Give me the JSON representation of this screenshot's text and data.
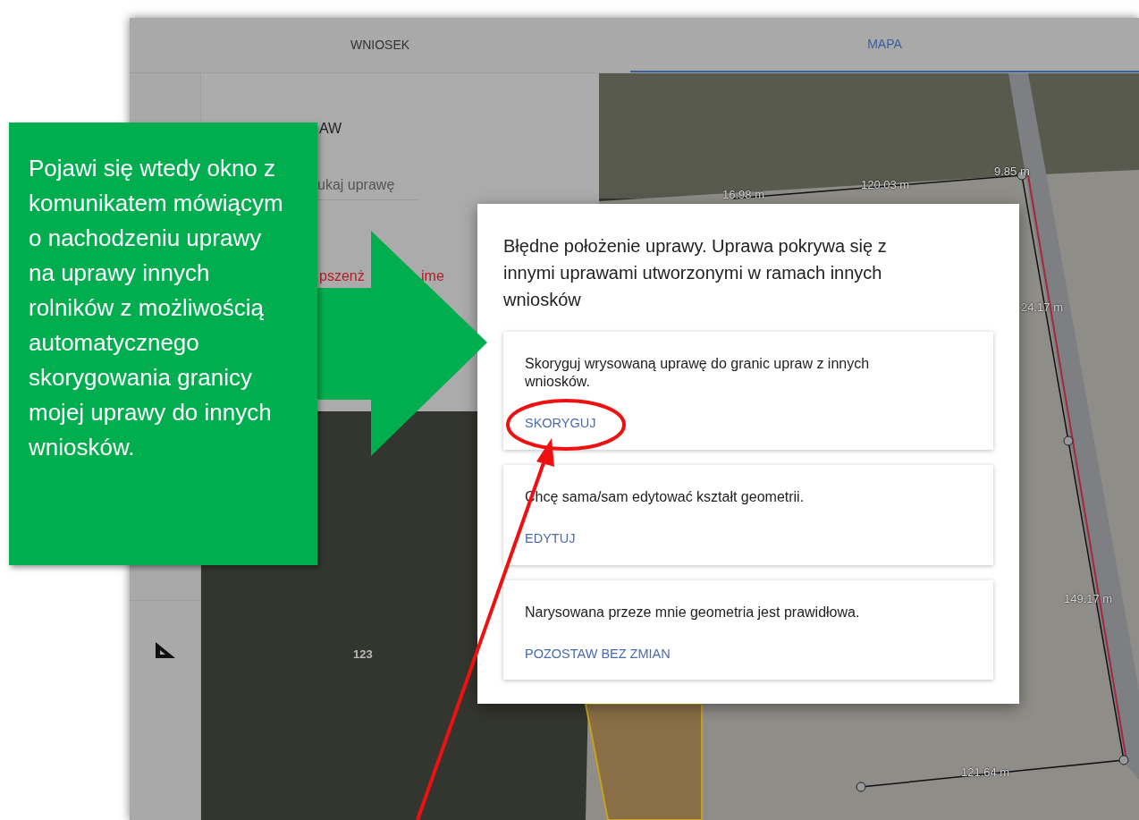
{
  "tabs": [
    {
      "label": "WNIOSEK",
      "selected": false
    },
    {
      "label": "MAPA",
      "selected": true
    }
  ],
  "crop_list": {
    "heading": "AW",
    "search": {
      "placeholder": "ukaj uprawę"
    },
    "item_fragments": [
      "pszenż",
      "ime"
    ]
  },
  "map": {
    "labels": [
      "16.98 m",
      "120.03 m",
      "9.85 m",
      "24.17 m",
      "149.17 m",
      "121.64 m"
    ],
    "parcel_number": "123"
  },
  "dialog": {
    "title": "Błędne położenie uprawy. Uprawa pokrywa się z innymi uprawami utworzonymi w ramach innych wniosków",
    "options": [
      {
        "text": "Skoryguj wrysowaną uprawę do granic upraw z innych wniosków.",
        "action": "SKORYGUJ"
      },
      {
        "text": "Chcę sama/sam edytować kształt geometrii.",
        "action": "EDYTUJ"
      },
      {
        "text": "Narysowana przeze mnie geometria jest prawidłowa.",
        "action": "POZOSTAW BEZ ZMIAN"
      }
    ]
  },
  "annotation": {
    "text": "Pojawi się wtedy okno z komunikatem mówiącym o nachodzeniu uprawy na uprawy innych rolników z możliwością automatycznego skorygowania granicy mojej uprawy do innych wniosków."
  }
}
